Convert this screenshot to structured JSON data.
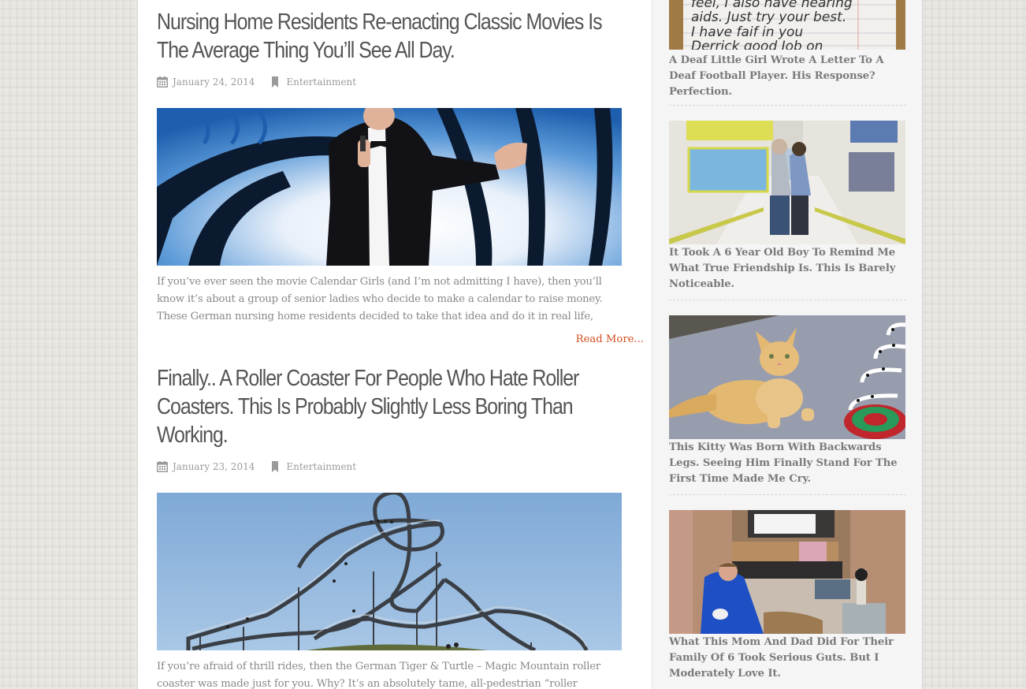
{
  "posts": [
    {
      "title": "Nursing Home Residents Re-enacting Classic Movies Is The Average Thing You’ll See All Day.",
      "date": "January 24, 2014",
      "category": "Entertainment",
      "image_alt": "Elderly man in tuxedo posing as James Bond with pistol",
      "excerpt": "If you’ve ever seen the movie Calendar Girls (and I’m not admitting I have), then you’ll know it’s about a group of senior ladies who decide to make a calendar to raise money. These German nursing home residents decided to take that idea and do it in real life,",
      "read_more": "Read More..."
    },
    {
      "title": "Finally.. A Roller Coaster For People Who Hate Roller Coasters. This Is Probably Slightly Less Boring Than Working.",
      "date": "January 23, 2014",
      "category": "Entertainment",
      "image_alt": "Tiger & Turtle walkable roller coaster sculpture with people walking on it",
      "excerpt": "If you’re afraid of thrill rides, then the German Tiger & Turtle – Magic Mountain roller coaster was made just for you. Why? It’s an absolutely tame, all-pedestrian “roller"
    }
  ],
  "sidebar": {
    "items": [
      {
        "title": "A Deaf Little Girl Wrote A Letter To A Deaf Football Player. His Response? Perfection.",
        "image_alt": "Handwritten letter on lined paper",
        "image_text": [
          "feel, I also have hearing",
          "aids. Just try your best.",
          "I have faif in you",
          "Derrick good Job on"
        ]
      },
      {
        "title": "It Took A 6 Year Old Boy To Remind Me What True Friendship Is. This Is Barely Noticeable.",
        "image_alt": "Two boys walking arm in arm down a school hallway"
      },
      {
        "title": "This Kitty Was Born With Backwards Legs. Seeing Him Finally Stand For The First Time Made Me Cry.",
        "image_alt": "Orange kitten with backwards legs next to a spring toy"
      },
      {
        "title": "What This Mom And Dad Did For Their Family Of 6 Took Serious Guts. But I Moderately Love It.",
        "image_alt": "Man in blue coveralls renovating the interior of a bus"
      }
    ]
  },
  "colors": {
    "accent": "#d54e21",
    "title": "#555555",
    "meta": "#9a9a9a",
    "excerpt": "#888888",
    "sidebar_title": "#7a7a7a"
  }
}
